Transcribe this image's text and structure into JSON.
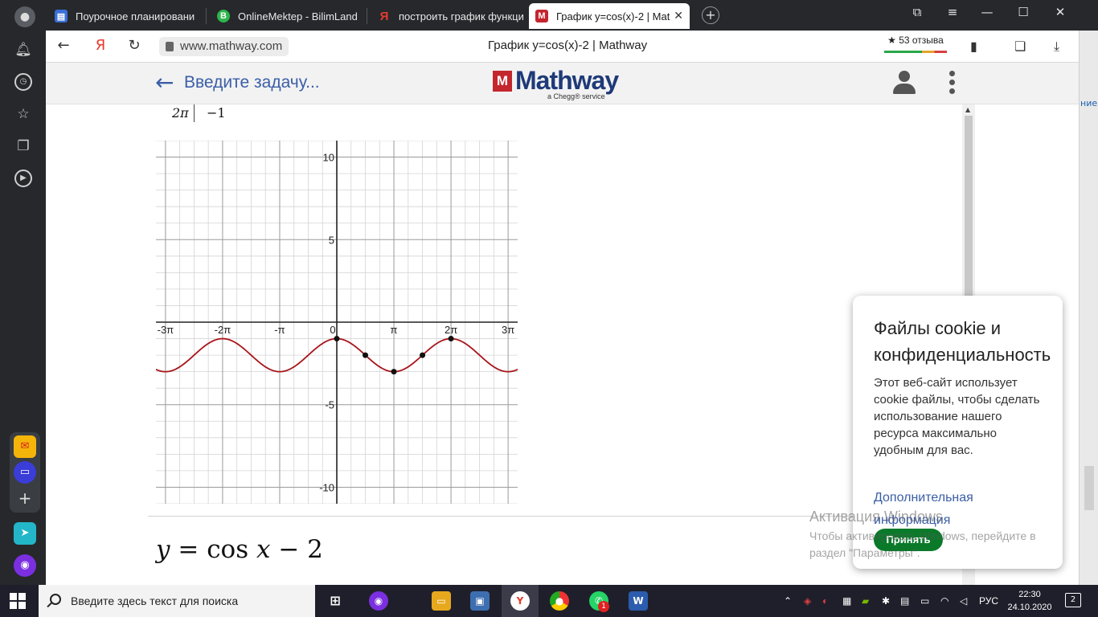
{
  "browser": {
    "tabs": [
      {
        "title": "Поурочное планировани",
        "icon": "document-icon",
        "color": "#3a6fd8"
      },
      {
        "title": "OnlineMektep - BilimLand",
        "icon": "bilimland-icon",
        "color": "#2db54b"
      },
      {
        "title": "построить график функци",
        "icon": "yandex-icon",
        "color": "#e63b2e"
      },
      {
        "title": "График y=cos(x)-2 | Mat",
        "icon": "mathway-icon",
        "color": "#c4262e"
      }
    ],
    "url": "www.mathway.com",
    "page_title": "График y=cos(x)-2 | Mathway",
    "reviews": "★ 53 отзыва"
  },
  "app": {
    "entry_placeholder": "Введите задачу...",
    "logo_word": "Mathway",
    "logo_sub": "a Chegg® service",
    "table_row": {
      "x": "2π",
      "y": "−1"
    }
  },
  "formula": {
    "lhs": "y",
    "eq": " = cos ",
    "var": "x",
    "rest": " − 2"
  },
  "chart_data": {
    "type": "line",
    "function": "y = cos(x) - 2",
    "xlim": [
      -9.95,
      9.95
    ],
    "ylim": [
      -11,
      11
    ],
    "x_ticks": [
      "-3π",
      "-2π",
      "-π",
      "0",
      "π",
      "2π",
      "3π"
    ],
    "x_tick_values": [
      -9.4248,
      -6.2832,
      -3.1416,
      0,
      3.1416,
      6.2832,
      9.4248
    ],
    "y_ticks": [
      "10",
      "5",
      "-5",
      "-10"
    ],
    "y_tick_values": [
      10,
      5,
      -5,
      -10
    ],
    "grid": true,
    "line_color": "#a8141a",
    "points": [
      {
        "x": 0,
        "y": -1
      },
      {
        "x": 1.5708,
        "y": -2
      },
      {
        "x": 3.1416,
        "y": -3
      },
      {
        "x": 4.7124,
        "y": -2
      },
      {
        "x": 6.2832,
        "y": -1
      }
    ]
  },
  "cookie": {
    "title": "Файлы cookie и конфиденциальность",
    "body": "Этот веб-сайт использует cookie файлы, чтобы сделать использование нашего ресурса максимально удобным для вас.",
    "link": "Дополнительная информация",
    "accept": "Принять"
  },
  "watermark": {
    "title": "Активация Windows",
    "text": "Чтобы активировать Windows, перейдите в раздел \"Параметры\"."
  },
  "right_edge_text": "ние",
  "taskbar": {
    "search_placeholder": "Введите здесь текст для поиска",
    "lang": "РУС",
    "time": "22:30",
    "date": "24.10.2020",
    "notifications": "2",
    "whatsapp_badge": "1"
  }
}
